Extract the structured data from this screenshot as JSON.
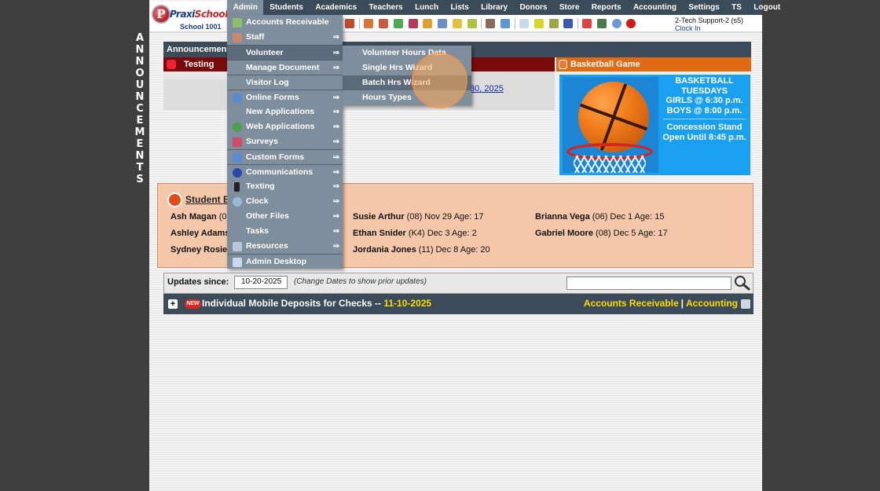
{
  "sidebar_vertical_text": [
    "A",
    "N",
    "N",
    "O",
    "U",
    "N",
    "C",
    "E",
    "M",
    "E",
    "N",
    "T",
    "S"
  ],
  "logo": {
    "brand_prefix": "Praxi",
    "brand_suffix": "School",
    "school": "School 1001"
  },
  "nav": [
    "Admin",
    "Students",
    "Academics",
    "Teachers",
    "Lunch",
    "Lists",
    "Library",
    "Donors",
    "Store",
    "Reports",
    "Accounting",
    "Settings",
    "TS",
    "Logout"
  ],
  "toolbar_icons": [
    "announce-icon",
    "teacher-icon",
    "student-icon",
    "money-icon",
    "group-icon",
    "lunch-icon",
    "book-icon",
    "pencil-icon",
    "library-icon",
    "people-icon",
    "clock-icon",
    "table-icon",
    "barcode-icon",
    "register-icon",
    "af-icon",
    "pdf-icon",
    "cash-icon",
    "help-icon",
    "power-icon"
  ],
  "user": {
    "name": "2-Tech Support-2 (s5)",
    "clock_link": "Clock In"
  },
  "announcements": {
    "bar_label": "Announcements",
    "testing": {
      "title": "Testing",
      "link": "30, 2025"
    },
    "basketball": {
      "title": "Basketball Game",
      "lines": [
        "BASKETBALL",
        "TUESDAYS",
        "GIRLS @ 6:30 p.m.",
        "BOYS  @ 8:00 p.m."
      ],
      "lines2": [
        "Concession Stand",
        "Open Until 8:45 p.m."
      ]
    }
  },
  "birthdays": {
    "title": "Student B",
    "col1": [
      {
        "name": "Ash Magan",
        "info": " (0"
      },
      {
        "name": "Ashley Adams",
        "info": ""
      },
      {
        "name": "Sydney Rosier",
        "info": ""
      }
    ],
    "col2": [
      {
        "name": "Susie Arthur",
        "info": " (08) Nov 29 Age: 17"
      },
      {
        "name": "Ethan Snider",
        "info": " (K4) Dec 3 Age: 2"
      },
      {
        "name": "Jordania Jones",
        "info": " (11) Dec 8 Age: 20"
      }
    ],
    "col3": [
      {
        "name": "Brianna Vega",
        "info": " (06) Dec 1 Age: 15"
      },
      {
        "name": "Gabriel Moore",
        "info": " (08) Dec 5 Age: 17"
      }
    ]
  },
  "updates": {
    "label": "Updates since:",
    "date_value": "10-20-2025",
    "hint": "(Change Dates to show prior updates)",
    "search_value": ""
  },
  "deposit": {
    "plus": "+",
    "new_badge": "NEW",
    "title": "Individual Mobile Deposits for Checks -- ",
    "date": "11-10-2025",
    "link1": "Accounts Receivable",
    "separator": "|",
    "link2": "Accounting"
  },
  "admin_menu": [
    {
      "label": "Accounts Receivable",
      "arrow": "",
      "icon": "money-icon"
    },
    {
      "label": "Staff",
      "arrow": "⇒",
      "icon": "staff-icon"
    },
    {
      "label": "Volunteer",
      "arrow": "⇒",
      "icon": ""
    },
    {
      "label": "Manage Document",
      "arrow": "⇒",
      "icon": ""
    },
    {
      "label": "Visitor Log",
      "arrow": "",
      "icon": ""
    },
    {
      "label": "Online Forms",
      "arrow": "⇒",
      "icon": "online-forms-icon"
    },
    {
      "label": "New Applications",
      "arrow": "⇒",
      "icon": ""
    },
    {
      "label": "Web Applications",
      "arrow": "⇒",
      "icon": "globe-icon"
    },
    {
      "label": "Surveys",
      "arrow": "⇒",
      "icon": "survey-icon"
    },
    {
      "label": "Custom Forms",
      "arrow": "⇒",
      "icon": "custom-forms-icon"
    },
    {
      "label": "Communications",
      "arrow": "⇒",
      "icon": "at-icon"
    },
    {
      "label": "Texting",
      "arrow": "⇒",
      "icon": "phone-icon"
    },
    {
      "label": "Clock",
      "arrow": "⇒",
      "icon": "clock-icon"
    },
    {
      "label": "Other Files",
      "arrow": "⇒",
      "icon": ""
    },
    {
      "label": "Tasks",
      "arrow": "⇒",
      "icon": ""
    },
    {
      "label": "Resources",
      "arrow": "⇒",
      "icon": "resources-icon"
    },
    {
      "label": "Admin Desktop",
      "arrow": "",
      "icon": "desktop-icon"
    }
  ],
  "volunteer_submenu": [
    "Volunteer Hours Data",
    "Single Hrs Wizard",
    "Batch Hrs Wizard",
    "Hours Types"
  ]
}
